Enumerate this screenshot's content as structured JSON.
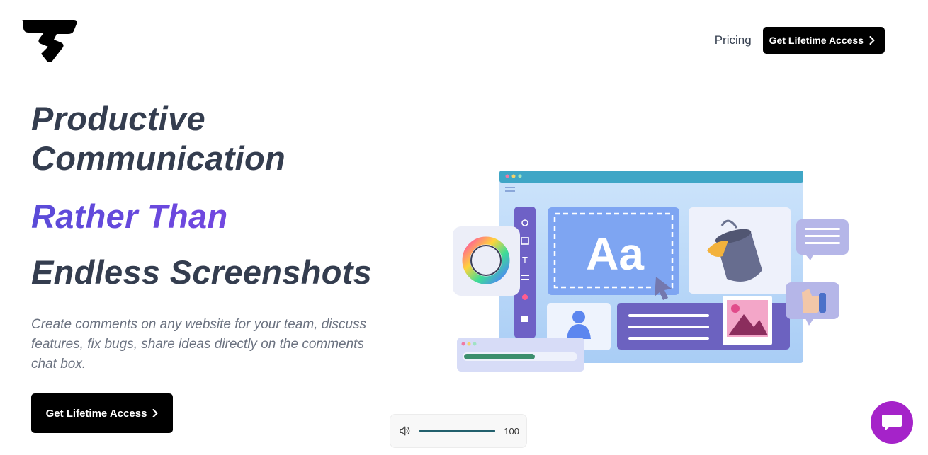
{
  "header": {
    "logo_icon": "brand-logo-icon",
    "nav_pricing": "Pricing",
    "nav_cta": "Get Lifetime Access"
  },
  "hero": {
    "line1": "Productive",
    "line2": "Communication",
    "line3": "Rather Than",
    "line4": "Endless Screenshots",
    "subtitle": "Create comments on any website for your team, discuss features, fix bugs, share ideas directly on the comments chat box.",
    "cta": "Get Lifetime Access"
  },
  "illustration": {
    "text": "Aa"
  },
  "audio": {
    "volume": 100,
    "volume_label": "100"
  },
  "chat": {
    "icon": "chat-icon"
  },
  "colors": {
    "accent_start": "#5a4bd8",
    "accent_end": "#8a44e8",
    "heading": "#343d4f",
    "chat_bubble": "#a523c9",
    "volume_fill": "#22606d"
  }
}
